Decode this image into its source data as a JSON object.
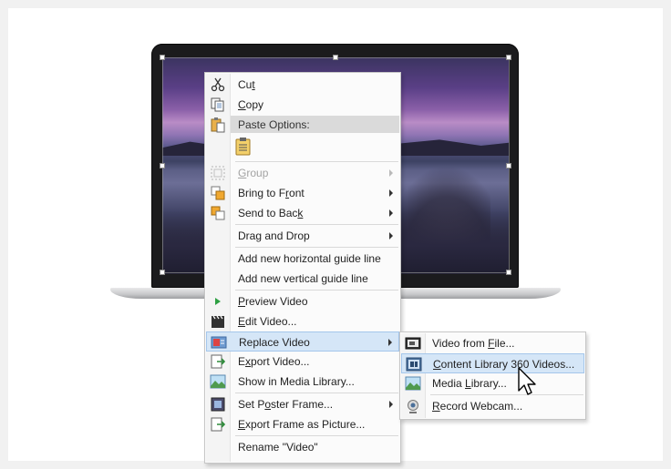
{
  "context_menu": {
    "items": [
      {
        "label": "Cut",
        "icon": "scissors-icon"
      },
      {
        "label": "Copy",
        "icon": "copy-icon"
      },
      {
        "label": "Paste Options:",
        "icon": "paste-icon"
      },
      {
        "label": "Group",
        "icon": "group-icon",
        "disabled": true
      },
      {
        "label": "Bring to Front",
        "icon": "bring-to-front-icon"
      },
      {
        "label": "Send to Back",
        "icon": "send-to-back-icon"
      },
      {
        "label": "Drag and Drop"
      },
      {
        "label": "Add new horizontal guide line"
      },
      {
        "label": "Add new vertical guide line"
      },
      {
        "label": "Preview Video",
        "icon": "play-icon"
      },
      {
        "label": "Edit Video...",
        "icon": "clapperboard-icon"
      },
      {
        "label": "Replace Video",
        "icon": "replace-video-icon",
        "highlighted": true
      },
      {
        "label": "Export Video...",
        "icon": "export-icon"
      },
      {
        "label": "Show in Media Library...",
        "icon": "media-library-icon"
      },
      {
        "label": "Set Poster Frame...",
        "icon": "poster-frame-icon"
      },
      {
        "label": "Export Frame as Picture...",
        "icon": "export-frame-icon"
      },
      {
        "label": "Rename \"Video\""
      }
    ]
  },
  "submenu": {
    "items": [
      {
        "label": "Video from File...",
        "icon": "video-file-icon"
      },
      {
        "label": "Content Library 360 Videos...",
        "icon": "content-library-icon",
        "highlighted": true
      },
      {
        "label": "Media Library...",
        "icon": "media-library-icon"
      },
      {
        "label": "Record Webcam...",
        "icon": "webcam-icon"
      }
    ]
  },
  "colors": {
    "highlight": "#d5e6f7",
    "highlight_border": "#a4c6eb",
    "disabled_text": "#a3a3a3",
    "play_green": "#2ea043"
  }
}
